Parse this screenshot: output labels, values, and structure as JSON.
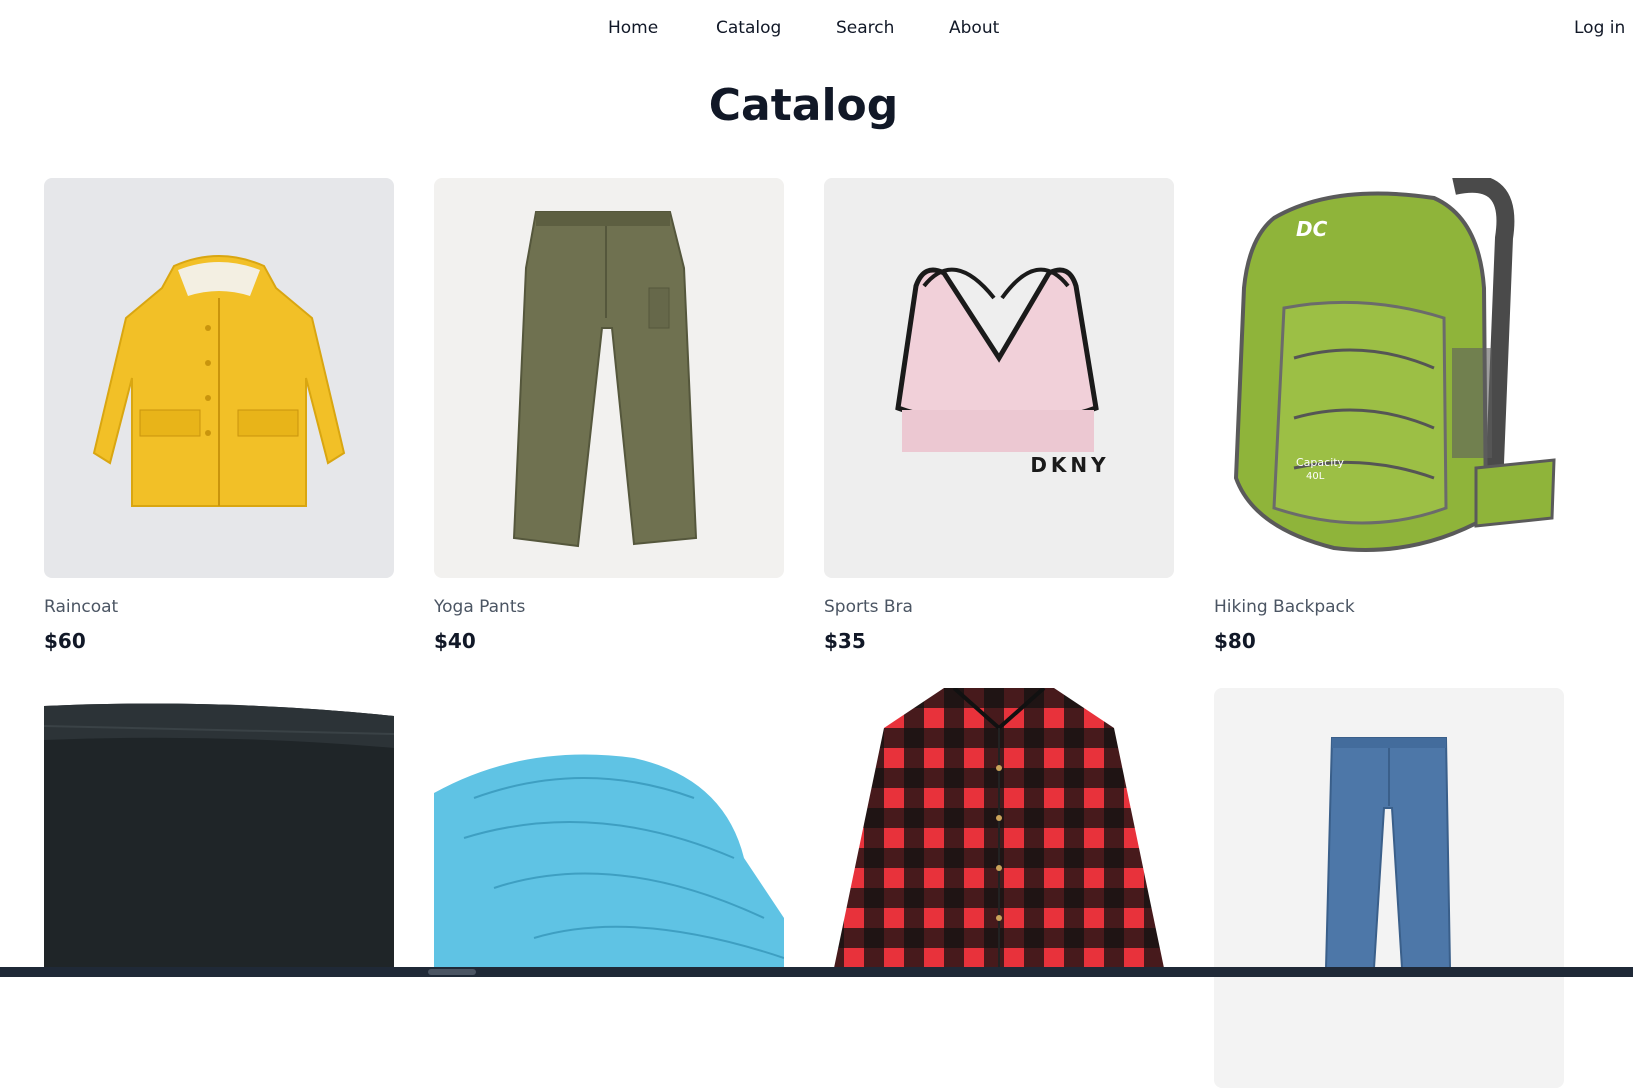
{
  "nav": {
    "links": [
      {
        "label": "Home"
      },
      {
        "label": "Catalog"
      },
      {
        "label": "Search"
      },
      {
        "label": "About"
      }
    ],
    "login_label": "Log in"
  },
  "page": {
    "title": "Catalog"
  },
  "products": [
    {
      "name": "Raincoat",
      "price": "$60",
      "image": "yellow-raincoat"
    },
    {
      "name": "Yoga Pants",
      "price": "$40",
      "image": "olive-pants"
    },
    {
      "name": "Sports Bra",
      "price": "$35",
      "image": "pink-sports-bra",
      "logo_text": "DKNY"
    },
    {
      "name": "Hiking Backpack",
      "price": "$80",
      "image": "green-backpack",
      "logo_text": "Capacity 40L"
    },
    {
      "name": "",
      "price": "",
      "image": "black-shorts"
    },
    {
      "name": "",
      "price": "",
      "image": "blue-sun-hat"
    },
    {
      "name": "",
      "price": "",
      "image": "red-plaid-shirt"
    },
    {
      "name": "",
      "price": "",
      "image": "blue-jeans"
    }
  ],
  "colors": {
    "text": "#111827",
    "muted": "#4b5563",
    "raincoat": "#f2c027",
    "pants": "#6f7150",
    "bra": "#f1d0d9",
    "backpack": "#8fb43a",
    "hat": "#5fc3e4",
    "plaid_red": "#e8323b",
    "denim": "#4d77a8"
  }
}
